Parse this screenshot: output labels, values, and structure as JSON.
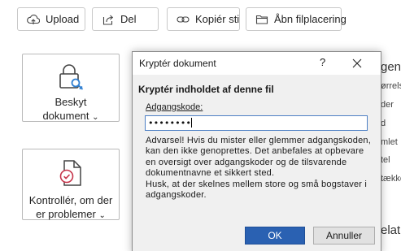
{
  "toolbar": {
    "upload_label": "Upload",
    "share_label": "Del",
    "copy_path_label": "Kopiér sti",
    "open_location_label": "Åbn filplacering"
  },
  "tiles": {
    "protect": {
      "line1": "Beskyt",
      "line2": "dokument"
    },
    "check": {
      "line1": "Kontrollér, om der",
      "line2": "er problemer"
    }
  },
  "background_right": {
    "items": [
      "gens",
      "ørrels",
      "der",
      "d",
      "mlet",
      "tel",
      "tække",
      "elat"
    ]
  },
  "dialog": {
    "title": "Kryptér dokument",
    "help": "?",
    "heading": "Kryptér indholdet af denne fil",
    "password_label": "Adgangskode:",
    "password_value": "••••••••",
    "warning": "Advarsel! Hvis du mister eller glemmer adgangskoden, kan den ikke genoprettes. Det anbefales at opbevare en oversigt over adgangskoder og de tilsvarende dokumentnavne et sikkert sted.",
    "note": "Husk, at der skelnes mellem store og små bogstaver i adgangskoder.",
    "ok_label": "OK",
    "cancel_label": "Annuller"
  },
  "colors": {
    "accent": "#2a61b2",
    "dialog_bg": "#f0f0f0",
    "focus_border": "#4d7fc4"
  },
  "icons": {
    "upload": "cloud-upload-icon",
    "share": "share-icon",
    "copy_path": "link-icon",
    "open_location": "folder-icon",
    "protect": "lock-key-icon",
    "check": "document-check-icon",
    "close": "close-icon"
  }
}
